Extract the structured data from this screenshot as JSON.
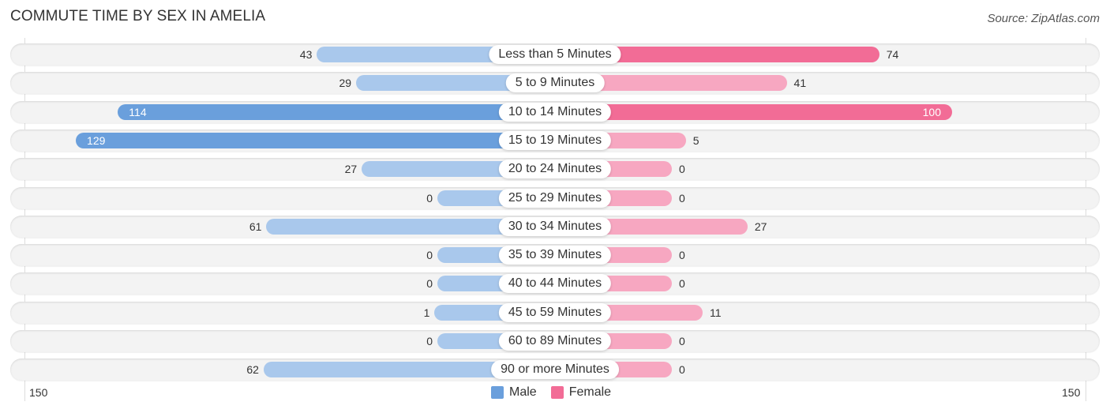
{
  "header": {
    "title": "COMMUTE TIME BY SEX IN AMELIA",
    "source": "Source: ZipAtlas.com"
  },
  "colors": {
    "male": "#6a9fdc",
    "male_light": "#a9c8ec",
    "female": "#f26c96",
    "female_light": "#f7a7c1"
  },
  "chart_data": {
    "type": "bar",
    "orientation": "horizontal-diverging",
    "title": "COMMUTE TIME BY SEX IN AMELIA",
    "categories": [
      "Less than 5 Minutes",
      "5 to 9 Minutes",
      "10 to 14 Minutes",
      "15 to 19 Minutes",
      "20 to 24 Minutes",
      "25 to 29 Minutes",
      "30 to 34 Minutes",
      "35 to 39 Minutes",
      "40 to 44 Minutes",
      "45 to 59 Minutes",
      "60 to 89 Minutes",
      "90 or more Minutes"
    ],
    "series": [
      {
        "name": "Male",
        "values": [
          43,
          29,
          114,
          129,
          27,
          0,
          61,
          0,
          0,
          1,
          0,
          62
        ]
      },
      {
        "name": "Female",
        "values": [
          74,
          41,
          100,
          5,
          0,
          0,
          27,
          0,
          0,
          11,
          0,
          0
        ]
      }
    ],
    "axis": {
      "min_label": "150",
      "max_label": "150",
      "range": [
        -150,
        150
      ]
    },
    "legend": {
      "position": "bottom-center",
      "entries": [
        "Male",
        "Female"
      ]
    },
    "xlabel": "",
    "ylabel": ""
  }
}
